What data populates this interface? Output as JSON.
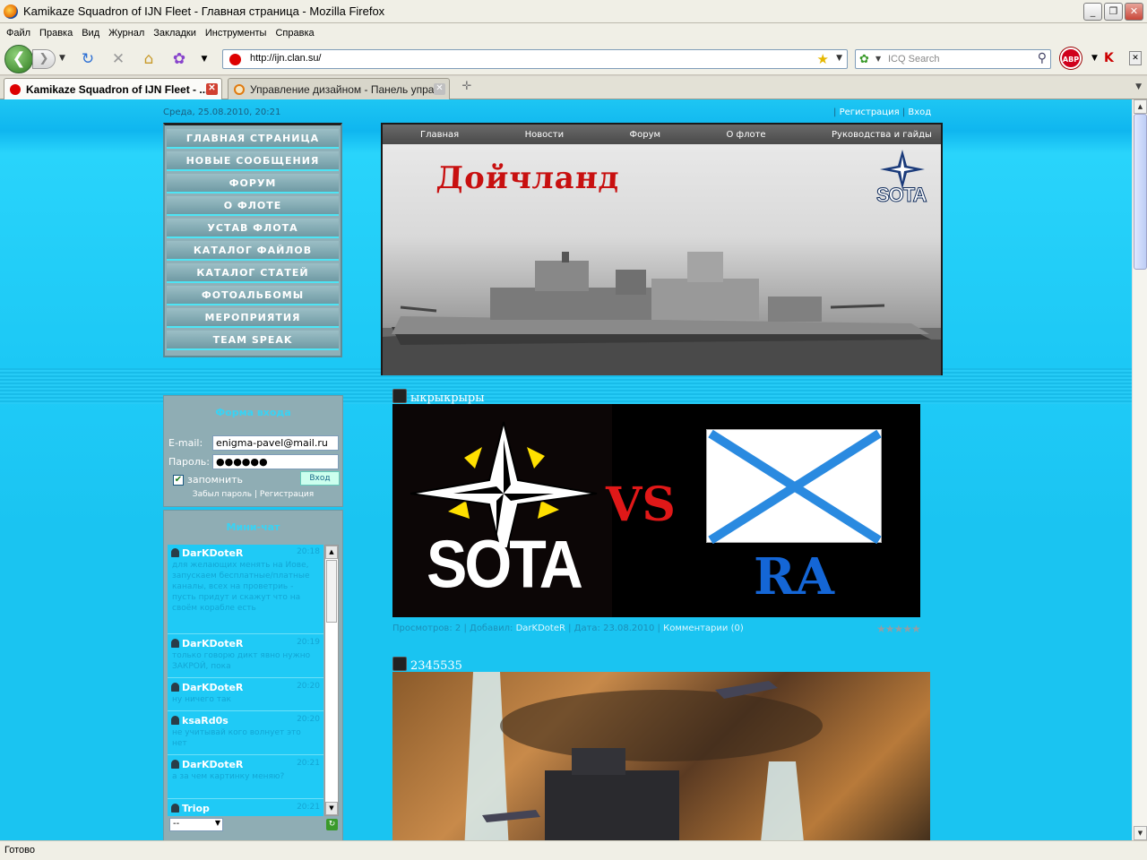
{
  "window": {
    "title": "Kamikaze Squadron of IJN Fleet - Главная страница - Mozilla Firefox",
    "buttons": [
      "_",
      "❐",
      "✕"
    ]
  },
  "menu": [
    "Файл",
    "Правка",
    "Вид",
    "Журнал",
    "Закладки",
    "Инструменты",
    "Справка"
  ],
  "url": "http://ijn.clan.su/",
  "search": {
    "placeholder": "ICQ Search"
  },
  "tabs": [
    {
      "label": "Kamikaze Squadron of IJN Fleet - ...",
      "active": true
    },
    {
      "label": "Управление дизайном - Панель упра...",
      "active": false
    }
  ],
  "status": "Готово",
  "site": {
    "date": "Среда, 25.08.2010, 20:21",
    "top_links": {
      "register": "Регистрация",
      "login": "Вход",
      "sep": "|"
    },
    "menu": [
      "ГЛАВНАЯ СТРАНИЦА",
      "НОВЫЕ СООБЩЕНИЯ",
      "ФОРУМ",
      "О ФЛОТЕ",
      "УСТАВ ФЛОТА",
      "КАТАЛОГ ФАЙЛОВ",
      "КАТАЛОГ СТАТЕЙ",
      "ФОТОАЛЬБОМЫ",
      "МЕРОПРИЯТИЯ",
      "TEAM SPEAK"
    ],
    "login_form": {
      "title": "Форма входа",
      "email_label": "E-mail:",
      "email_value": "enigma-pavel@mail.ru",
      "password_label": "Пароль:",
      "password_value": "●●●●●●",
      "remember": "запомнить",
      "submit": "Вход",
      "forgot": "Забыл пароль",
      "register": "Регистрация"
    },
    "chat": {
      "title": "Мини-чат",
      "messages": [
        {
          "user": "DarKDoteR",
          "time": "20:18",
          "text": "для желающих менять на Иове, запускаем бесплатные/платные каналы, всех на проветриь - пусть придут и скажут что на своём корабле есть"
        },
        {
          "user": "DarKDoteR",
          "time": "20:19",
          "text": "только говорю дикт явно нужно ЗАКРОЙ, пока"
        },
        {
          "user": "DarKDoteR",
          "time": "20:20",
          "text": "ну ничего так"
        },
        {
          "user": "ksaRd0s",
          "time": "20:20",
          "text": "не учитывай кого волнует это нет"
        },
        {
          "user": "DarKDoteR",
          "time": "20:21",
          "text": "а за чем картинку меняю?"
        },
        {
          "user": "Triop",
          "time": "20:21",
          "text": ""
        }
      ],
      "select_value": "--"
    },
    "top_nav": [
      "Главная",
      "Новости",
      "Форум",
      "О флоте",
      "Руководства и гайды"
    ],
    "banner": {
      "title": "Дойчланд",
      "logo_text": "SOTA"
    },
    "posts": [
      {
        "title": "ыкрыкрыры",
        "image": {
          "left_text": "SOTA",
          "vs": "VS",
          "right_text": "RA"
        },
        "meta": {
          "views_label": "Просмотров:",
          "views": "2",
          "added_label": "Добавил:",
          "author": "DarKDoteR",
          "date_label": "Дата:",
          "date": "23.08.2010",
          "comments": "Комментарии (0)"
        },
        "rating_stars": "★★★★★"
      },
      {
        "title": "2345535"
      }
    ]
  },
  "colors": {
    "page_bg": "#1ec6f3",
    "menu_bg": "#8fb0b8",
    "menu_line": "#4ee4f4",
    "banner_title": "#c81010"
  }
}
